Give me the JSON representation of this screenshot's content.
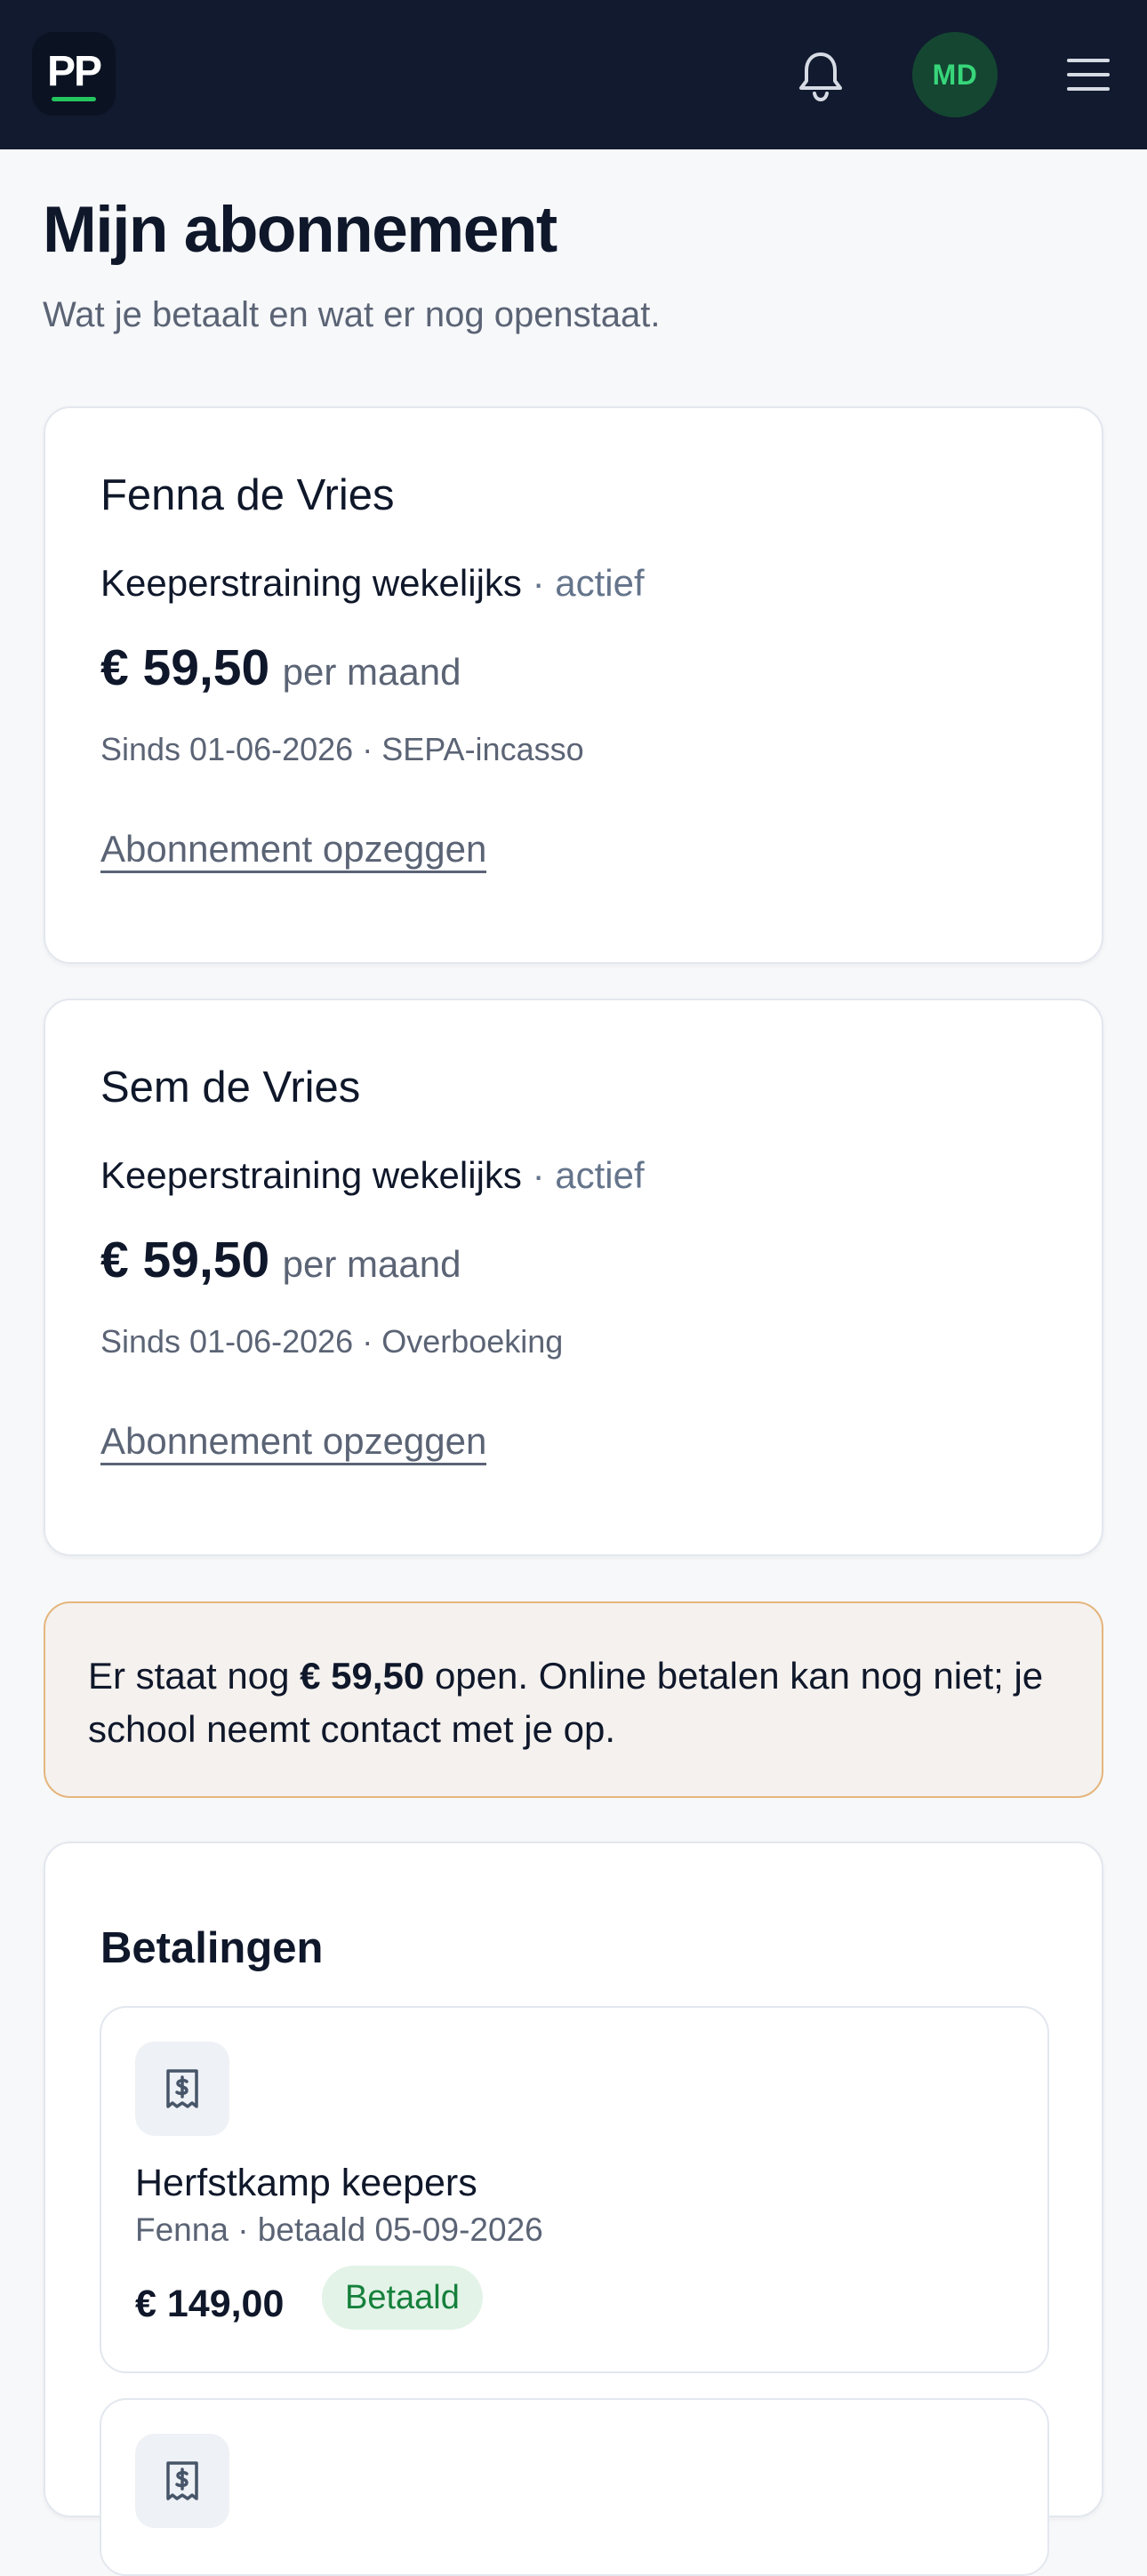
{
  "header": {
    "logo_text": "PP",
    "avatar_initials": "MD",
    "icons": {
      "notifications": "bell-icon",
      "menu": "hamburger-menu-icon"
    },
    "colors": {
      "bar": "#111a2e",
      "accent": "#22c55e",
      "avatar_bg": "#144632",
      "avatar_text": "#37d67a"
    }
  },
  "page": {
    "title": "Mijn abonnement",
    "subtitle": "Wat je betaalt en wat er nog openstaat."
  },
  "subscriptions": [
    {
      "name": "Fenna de Vries",
      "plan": "Keeperstraining wekelijks",
      "separator": "·",
      "status": "actief",
      "price": "€ 59,50",
      "period": "per maand",
      "meta": "Sinds 01-06-2026 · SEPA-incasso",
      "cancel_label": "Abonnement opzeggen"
    },
    {
      "name": "Sem de Vries",
      "plan": "Keeperstraining wekelijks",
      "separator": "·",
      "status": "actief",
      "price": "€ 59,50",
      "period": "per maand",
      "meta": "Sinds 01-06-2026 · Overboeking",
      "cancel_label": "Abonnement opzeggen"
    }
  ],
  "notice": {
    "prefix": "Er staat nog",
    "amount": "€ 59,50",
    "suffix": "open. Online betalen kan nog niet; je school neemt contact met je op.",
    "colors": {
      "background": "#f4f1ee",
      "border": "#e5b57c"
    }
  },
  "payments": {
    "title": "Betalingen",
    "items": [
      {
        "icon": "receipt-icon",
        "title": "Herfstkamp keepers",
        "subtitle": "Fenna · betaald 05-09-2026",
        "amount": "€ 149,00",
        "badge": "Betaald",
        "badge_color": "#16803c"
      },
      {
        "icon": "receipt-icon"
      }
    ]
  }
}
